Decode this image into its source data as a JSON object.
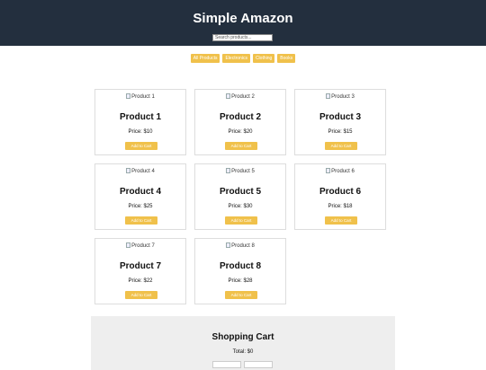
{
  "header": {
    "title": "Simple Amazon",
    "search_placeholder": "Search products..."
  },
  "filters": [
    "All Products",
    "Electronics",
    "Clothing",
    "Books"
  ],
  "products": [
    {
      "image_alt": "Product 1",
      "name": "Product 1",
      "price": "Price: $10",
      "button": "Add to Cart"
    },
    {
      "image_alt": "Product 2",
      "name": "Product 2",
      "price": "Price: $20",
      "button": "Add to Cart"
    },
    {
      "image_alt": "Product 3",
      "name": "Product 3",
      "price": "Price: $15",
      "button": "Add to Cart"
    },
    {
      "image_alt": "Product 4",
      "name": "Product 4",
      "price": "Price: $25",
      "button": "Add to Cart"
    },
    {
      "image_alt": "Product 5",
      "name": "Product 5",
      "price": "Price: $30",
      "button": "Add to Cart"
    },
    {
      "image_alt": "Product 6",
      "name": "Product 6",
      "price": "Price: $18",
      "button": "Add to Cart"
    },
    {
      "image_alt": "Product 7",
      "name": "Product 7",
      "price": "Price: $22",
      "button": "Add to Cart"
    },
    {
      "image_alt": "Product 8",
      "name": "Product 8",
      "price": "Price: $28",
      "button": "Add to Cart"
    }
  ],
  "cart": {
    "title": "Shopping Cart",
    "total": "Total: $0"
  },
  "colors": {
    "header_bg": "#232f3e",
    "accent": "#f0c14b",
    "cart_bg": "#eeeeee"
  }
}
